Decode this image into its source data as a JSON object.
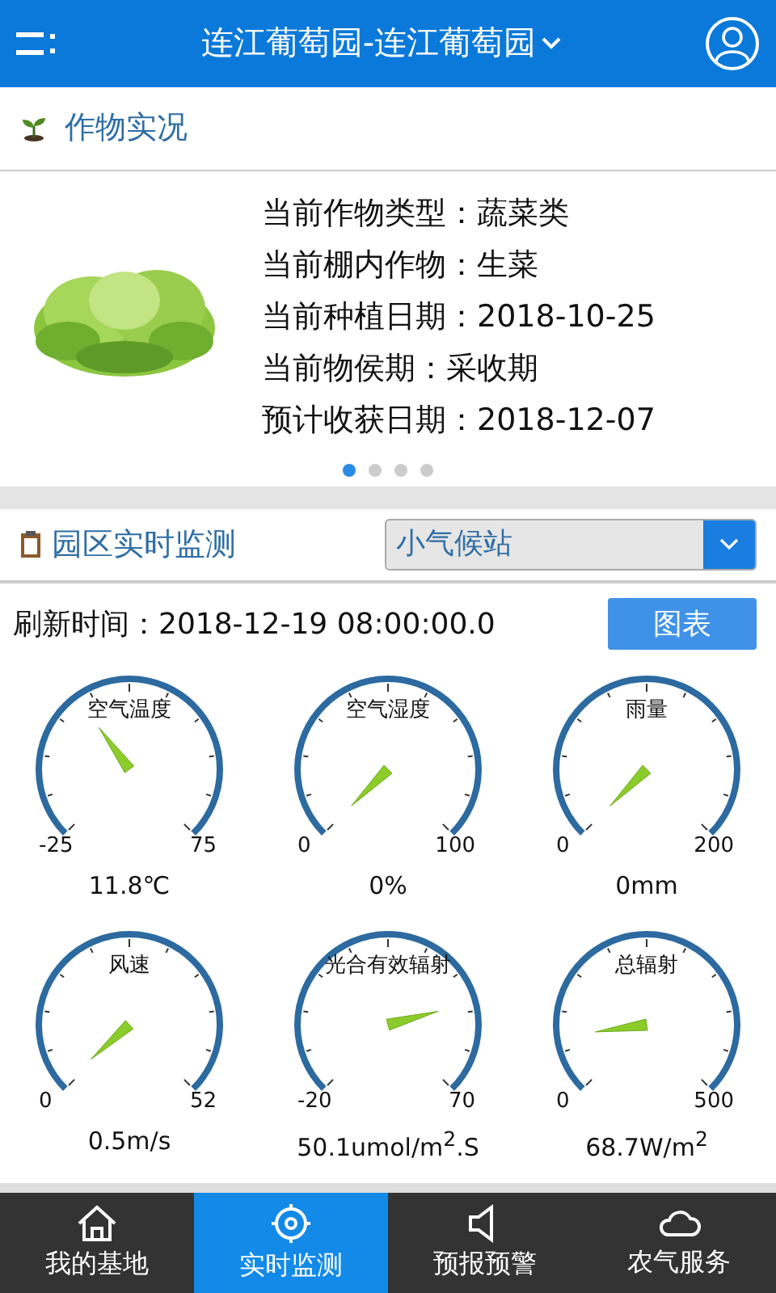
{
  "header": {
    "title": "连江葡萄园-连江葡萄园"
  },
  "crop_section": {
    "title": "作物实况"
  },
  "crop_card": {
    "picture": {
      "kind": "picture"
    },
    "lines": [
      "当前作物类型：蔬菜类",
      "当前棚内作物：生菜",
      "当前种植日期：2018-10-25",
      "当前物侯期：采收期",
      "预计收获日期：2018-12-07"
    ],
    "dots": [
      {
        "selected": true
      },
      {
        "selected": false
      },
      {
        "selected": false
      },
      {
        "selected": false
      }
    ]
  },
  "monitor_section": {
    "title": "园区实时监测",
    "station": "小气候站"
  },
  "refresh": {
    "text": "刷新时间：2018-12-19 08:00:00.0",
    "chart_button": "图表"
  },
  "gauges": [
    {
      "name": "空气温度",
      "min": "-25",
      "max": "75",
      "reading": "11.8℃"
    },
    {
      "name": "空气湿度",
      "min": "0",
      "max": "100",
      "reading": "0%"
    },
    {
      "name": "雨量",
      "min": "0",
      "max": "200",
      "reading": "0mm"
    },
    {
      "name": "风速",
      "min": "0",
      "max": "52",
      "reading": "0.5m/s"
    },
    {
      "name": "光合有效辐射",
      "min": "-20",
      "max": "70",
      "reading": "50.1umol/m$^{2}$.S"
    },
    {
      "name": "总辐射",
      "min": "0",
      "max": "500",
      "reading": "68.7W/m$^{2}$"
    }
  ],
  "tab_bar": [
    {
      "kind": "home",
      "label": "我的基地",
      "selected": false
    },
    {
      "kind": "target",
      "label": "实时监测",
      "selected": true
    },
    {
      "kind": "speaker",
      "label": "预报预警",
      "selected": false
    },
    {
      "kind": "cloud",
      "label": "农气服务",
      "selected": false
    }
  ]
}
